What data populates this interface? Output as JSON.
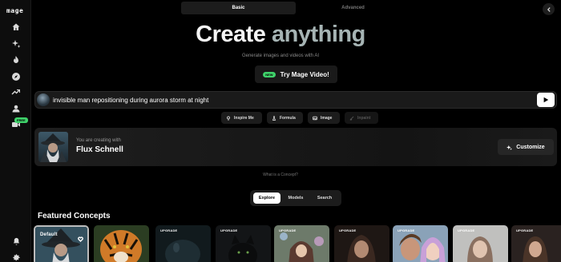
{
  "app": {
    "logo": "maɡe"
  },
  "sidebar": {
    "items": [
      {
        "icon": "home-icon"
      },
      {
        "icon": "sparkles-icon"
      },
      {
        "icon": "flame-icon"
      },
      {
        "icon": "compass-icon"
      },
      {
        "icon": "trending-icon"
      },
      {
        "icon": "user-icon"
      },
      {
        "icon": "video-icon",
        "badge": "FREE"
      }
    ],
    "bottom": [
      {
        "icon": "bell-icon"
      },
      {
        "icon": "gear-icon"
      }
    ]
  },
  "mode_tabs": {
    "basic": "Basic",
    "advanced": "Advanced",
    "active": "Basic"
  },
  "hero": {
    "title_part1": "Create",
    "title_part2": "anything",
    "subtitle": "Generate images and videos with AI",
    "video_button": {
      "badge": "NEW",
      "label": "Try Mage Video!"
    }
  },
  "prompt": {
    "value": "invisible man repositioning during aurora storm at night"
  },
  "tools": {
    "inspire": "Inspire Me",
    "formula": "Formula",
    "image": "Image",
    "inpaint": "Inpaint"
  },
  "concept": {
    "label": "You are creating with",
    "name": "Flux Schnell",
    "customize": "Customize"
  },
  "what_is_concept": "What is a Concept?",
  "explore_tabs": {
    "explore": "Explore",
    "models": "Models",
    "search": "Search",
    "active": "Explore"
  },
  "featured": {
    "title": "Featured Concepts",
    "cards": [
      {
        "label": "Default"
      },
      {
        "label": ""
      },
      {
        "label": "UPGRADE"
      },
      {
        "label": "UPGRADE"
      },
      {
        "label": "UPGRADE"
      },
      {
        "label": "UPGRADE"
      },
      {
        "label": "UPGRADE"
      },
      {
        "label": "UPGRADE"
      },
      {
        "label": "UPGRADE"
      }
    ]
  },
  "colors": {
    "accent_green": "#3fd36b",
    "background": "#000000",
    "surface": "#1a1a1a"
  }
}
